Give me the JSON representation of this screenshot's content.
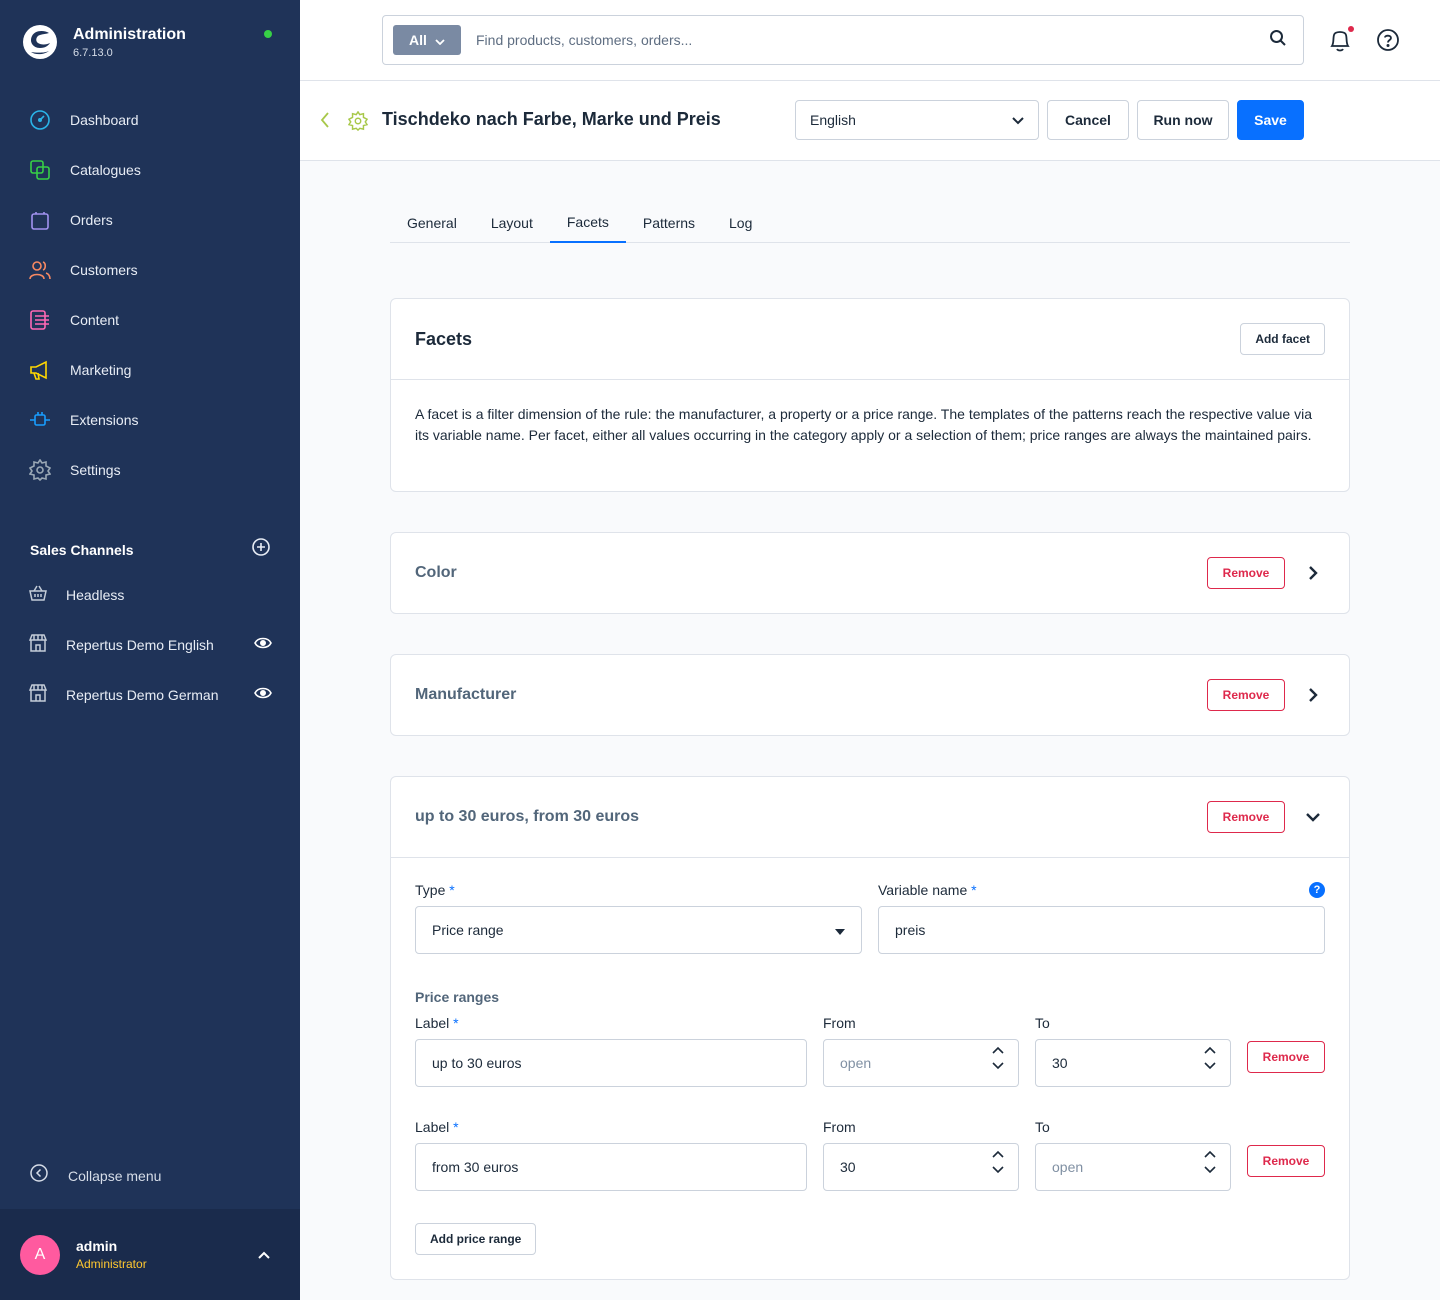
{
  "app": {
    "title": "Administration",
    "version": "6.7.13.0"
  },
  "sidebar": {
    "items": [
      {
        "label": "Dashboard",
        "icon": "dashboard-icon",
        "color": "#2ab4e8"
      },
      {
        "label": "Catalogues",
        "icon": "catalogue-icon",
        "color": "#37d046"
      },
      {
        "label": "Orders",
        "icon": "orders-icon",
        "color": "#a092f0"
      },
      {
        "label": "Customers",
        "icon": "customers-icon",
        "color": "#f88962"
      },
      {
        "label": "Content",
        "icon": "content-icon",
        "color": "#ff68b4"
      },
      {
        "label": "Marketing",
        "icon": "marketing-icon",
        "color": "#ffd700"
      },
      {
        "label": "Extensions",
        "icon": "extensions-icon",
        "color": "#189eff"
      },
      {
        "label": "Settings",
        "icon": "settings-icon",
        "color": "#9aa8b5"
      }
    ],
    "sales_channels_title": "Sales Channels",
    "sales_channels": [
      {
        "label": "Headless",
        "icon": "basket-icon",
        "visible_toggle": false
      },
      {
        "label": "Repertus Demo English",
        "icon": "storefront-icon",
        "visible_toggle": true
      },
      {
        "label": "Repertus Demo German",
        "icon": "storefront-icon",
        "visible_toggle": true
      }
    ],
    "collapse_label": "Collapse menu",
    "user": {
      "initial": "A",
      "name": "admin",
      "role": "Administrator"
    }
  },
  "topbar": {
    "search_type": "All",
    "search_placeholder": "Find products, customers, orders..."
  },
  "page": {
    "title": "Tischdeko nach Farbe, Marke und Preis",
    "language": "English",
    "cancel_label": "Cancel",
    "run_label": "Run now",
    "save_label": "Save"
  },
  "tabs": [
    {
      "label": "General",
      "active": false
    },
    {
      "label": "Layout",
      "active": false
    },
    {
      "label": "Facets",
      "active": true
    },
    {
      "label": "Patterns",
      "active": false
    },
    {
      "label": "Log",
      "active": false
    }
  ],
  "facets_card": {
    "title": "Facets",
    "add_label": "Add facet",
    "description": "A facet is a filter dimension of the rule: the manufacturer, a property or a price range. The templates of the patterns reach the respective value via its variable name. Per facet, either all values occurring in the category apply or a selection of them; price ranges are always the maintained pairs."
  },
  "facets": [
    {
      "title": "Color",
      "remove_label": "Remove",
      "expanded": false
    },
    {
      "title": "Manufacturer",
      "remove_label": "Remove",
      "expanded": false
    },
    {
      "title": "up to 30 euros, from 30 euros",
      "remove_label": "Remove",
      "expanded": true
    }
  ],
  "price_facet": {
    "type_label": "Type",
    "type_value": "Price range",
    "variable_label": "Variable name",
    "variable_value": "preis",
    "ranges_label": "Price ranges",
    "label_label": "Label",
    "from_label": "From",
    "to_label": "To",
    "required_mark": "*",
    "ranges": [
      {
        "label": "up to 30 euros",
        "from": "",
        "from_placeholder": "open",
        "to": "30",
        "to_placeholder": "",
        "remove_label": "Remove"
      },
      {
        "label": "from 30 euros",
        "from": "30",
        "from_placeholder": "",
        "to": "",
        "to_placeholder": "open",
        "remove_label": "Remove"
      }
    ],
    "add_range_label": "Add price range"
  },
  "colors": {
    "sidebar_bg": "#1f3358",
    "accent": "#0870ff",
    "danger": "#de294c",
    "online": "#37d046",
    "role": "#ffc830",
    "avatar": "#ff5a9f"
  }
}
